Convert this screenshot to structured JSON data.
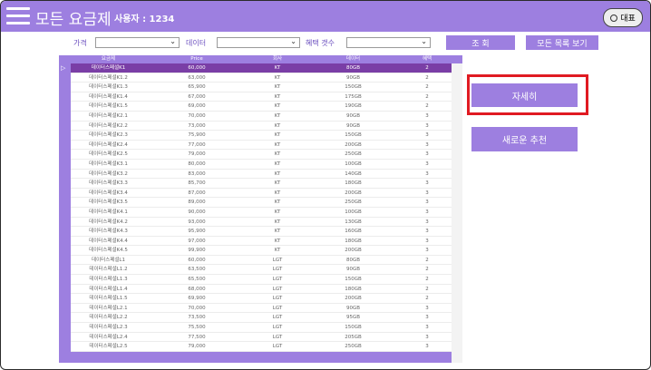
{
  "app": {
    "title": "모든 요금제",
    "user_label": "사용자 : 1234",
    "rep_button": "대표"
  },
  "filters": {
    "carrier_label": "가격",
    "data_label": "데이터",
    "benefits_label": "혜택 갯수",
    "carrier_value": "",
    "data_value": "",
    "benefits_value": ""
  },
  "actions": {
    "search": "조 회",
    "view_all": "모든 목록 보기",
    "details": "자세히",
    "new_recommend": "새로운 추천"
  },
  "table": {
    "columns": [
      "요금제",
      "Price",
      "회사",
      "데이터",
      "혜택"
    ],
    "rows": [
      [
        "데이터스페셜K1",
        "60,000",
        "KT",
        "80GB",
        "2"
      ],
      [
        "데이터스페셜K1.2",
        "63,000",
        "KT",
        "90GB",
        "2"
      ],
      [
        "데이터스페셜K1.3",
        "65,900",
        "KT",
        "150GB",
        "2"
      ],
      [
        "데이터스페셜K1.4",
        "67,000",
        "KT",
        "175GB",
        "2"
      ],
      [
        "데이터스페셜K1.5",
        "69,000",
        "KT",
        "190GB",
        "2"
      ],
      [
        "데이터스페셜K2.1",
        "70,000",
        "KT",
        "90GB",
        "3"
      ],
      [
        "데이터스페셜K2.2",
        "73,000",
        "KT",
        "90GB",
        "3"
      ],
      [
        "데이터스페셜K2.3",
        "75,900",
        "KT",
        "150GB",
        "3"
      ],
      [
        "데이터스페셜K2.4",
        "77,000",
        "KT",
        "200GB",
        "3"
      ],
      [
        "데이터스페셜K2.5",
        "79,000",
        "KT",
        "250GB",
        "3"
      ],
      [
        "데이터스페셜K3.1",
        "80,000",
        "KT",
        "100GB",
        "3"
      ],
      [
        "데이터스페셜K3.2",
        "83,000",
        "KT",
        "140GB",
        "3"
      ],
      [
        "데이터스페셜K3.3",
        "85,700",
        "KT",
        "180GB",
        "3"
      ],
      [
        "데이터스페셜K3.4",
        "87,000",
        "KT",
        "200GB",
        "3"
      ],
      [
        "데이터스페셜K3.5",
        "89,000",
        "KT",
        "250GB",
        "3"
      ],
      [
        "데이터스페셜K4.1",
        "90,000",
        "KT",
        "100GB",
        "3"
      ],
      [
        "데이터스페셜K4.2",
        "93,000",
        "KT",
        "130GB",
        "3"
      ],
      [
        "데이터스페셜K4.3",
        "95,900",
        "KT",
        "160GB",
        "3"
      ],
      [
        "데이터스페셜K4.4",
        "97,000",
        "KT",
        "180GB",
        "3"
      ],
      [
        "데이터스페셜K4.5",
        "99,900",
        "KT",
        "200GB",
        "3"
      ],
      [
        "데이터스페셜L1",
        "60,000",
        "LGT",
        "80GB",
        "2"
      ],
      [
        "데이터스페셜L1.2",
        "63,500",
        "LGT",
        "90GB",
        "2"
      ],
      [
        "데이터스페셜L1.3",
        "65,500",
        "LGT",
        "150GB",
        "2"
      ],
      [
        "데이터스페셜L1.4",
        "68,000",
        "LGT",
        "180GB",
        "2"
      ],
      [
        "데이터스페셜L1.5",
        "69,900",
        "LGT",
        "200GB",
        "2"
      ],
      [
        "데이터스페셜L2.1",
        "70,000",
        "LGT",
        "90GB",
        "3"
      ],
      [
        "데이터스페셜L2.2",
        "73,500",
        "LGT",
        "95GB",
        "3"
      ],
      [
        "데이터스페셜L2.3",
        "75,500",
        "LGT",
        "150GB",
        "3"
      ],
      [
        "데이터스페셜L2.4",
        "77,500",
        "LGT",
        "205GB",
        "3"
      ],
      [
        "데이터스페셜L2.5",
        "79,000",
        "LGT",
        "250GB",
        "3"
      ]
    ]
  }
}
